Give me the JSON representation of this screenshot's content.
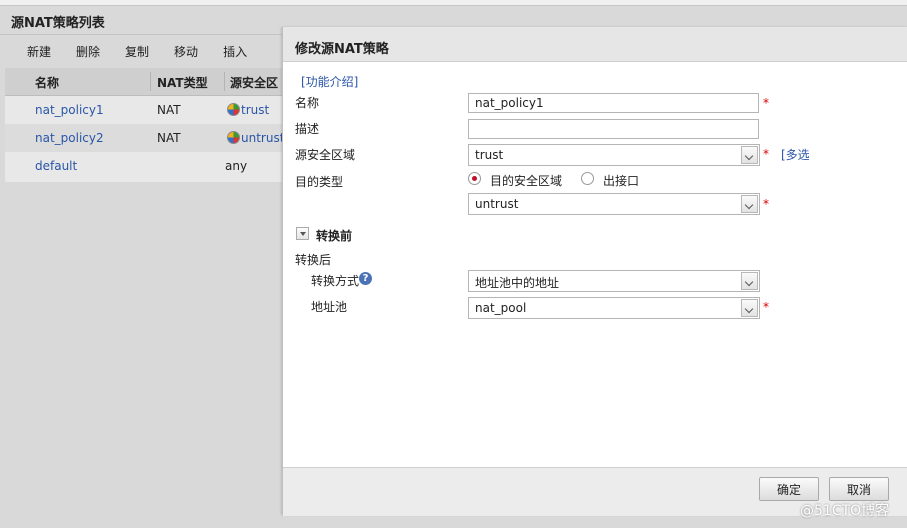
{
  "list_panel": {
    "title": "源NAT策略列表",
    "toolbar": [
      "新建",
      "删除",
      "复制",
      "移动",
      "插入"
    ],
    "columns": [
      "名称",
      "NAT类型",
      "源安全区"
    ],
    "rows": [
      {
        "name": "nat_policy1",
        "nat_type": "NAT",
        "src_zone": "trust",
        "zone_icon": "zone-icon"
      },
      {
        "name": "nat_policy2",
        "nat_type": "NAT",
        "src_zone": "untrust",
        "zone_icon": "zone-icon"
      },
      {
        "name": "default",
        "nat_type": "",
        "src_zone": "any"
      }
    ]
  },
  "dialog": {
    "title": "修改源NAT策略",
    "help_link": "[功能介绍]",
    "fields": {
      "name_label": "名称",
      "name_value": "nat_policy1",
      "desc_label": "描述",
      "desc_value": "",
      "src_zone_label": "源安全区域",
      "src_zone_value": "trust",
      "multi_select": "[多选",
      "dest_type_label": "目的类型",
      "radio_dest_zone": "目的安全区域",
      "radio_egress": "出接口",
      "dest_zone_value": "untrust",
      "before_label": "转换前",
      "after_label": "转换后",
      "method_label": "转换方式",
      "method_value": "地址池中的地址",
      "pool_label": "地址池",
      "pool_value": "nat_pool",
      "required_mark": "*",
      "help_icon": "?"
    },
    "buttons": {
      "ok": "确定",
      "cancel": "取消"
    }
  },
  "watermark": "@51CTO博客",
  "colors": {
    "link": "#2955a8",
    "required": "#d00000",
    "radio_selected": "#c0102a"
  }
}
